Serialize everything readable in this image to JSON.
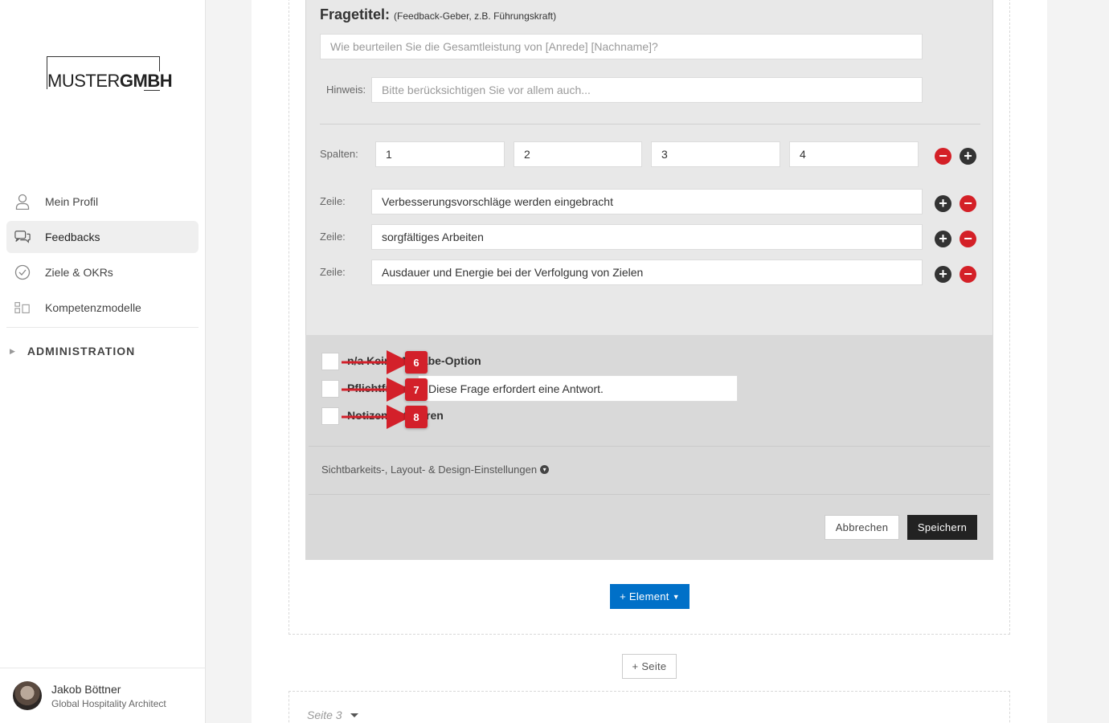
{
  "logo": {
    "part1": "MUSTER",
    "part2": "GMBH"
  },
  "sidebar": {
    "items": [
      {
        "label": "Mein Profil",
        "icon": "user-icon"
      },
      {
        "label": "Feedbacks",
        "icon": "chat-icon"
      },
      {
        "label": "Ziele & OKRs",
        "icon": "check-circle-icon"
      },
      {
        "label": "Kompetenzmodelle",
        "icon": "model-icon"
      }
    ],
    "admin_label": "ADMINISTRATION"
  },
  "user": {
    "name": "Jakob Böttner",
    "role": "Global Hospitality Architect"
  },
  "question": {
    "title_label": "Fragetitel:",
    "title_hint": "(Feedback-Geber, z.B. Führungskraft)",
    "title_placeholder": "Wie beurteilen Sie die Gesamtleistung von [Anrede] [Nachname]?",
    "hint_label": "Hinweis:",
    "hint_placeholder": "Bitte berücksichtigen Sie vor allem auch...",
    "columns_label": "Spalten:",
    "columns": [
      "1",
      "2",
      "3",
      "4"
    ],
    "row_label": "Zeile:",
    "rows": [
      "Verbesserungsvorschläge werden eingebracht",
      "sorgfältiges Arbeiten",
      "Ausdauer und Energie bei der Verfolgung von Zielen"
    ]
  },
  "options": {
    "no_answer": "n/a Keine Angabe-Option",
    "required": "Pflichtfrage",
    "required_text": "Diese Frage erfordert eine Antwort.",
    "notes": "Notizen aktivieren",
    "design_settings": "Sichtbarkeits-, Layout- & Design-Einstellungen",
    "cancel": "Abbrechen",
    "save": "Speichern"
  },
  "annotations": [
    "6",
    "7",
    "8"
  ],
  "add_element": "+ Element",
  "add_page": "+ Seite",
  "next_page": "Seite 3",
  "colors": {
    "primary": "#0070c8",
    "danger": "#d42027",
    "annotation": "#d3202a"
  }
}
